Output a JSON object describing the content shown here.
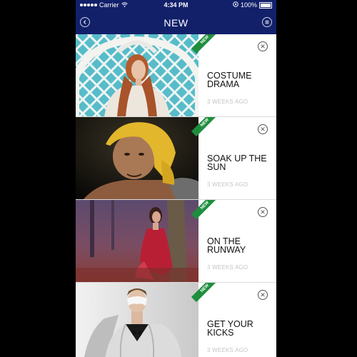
{
  "status": {
    "carrier": "Carrier",
    "time": "4:34 PM",
    "battery": "100%"
  },
  "navbar": {
    "title": "NEW",
    "left_icon": "back-arrow-icon",
    "right_icon": "menu-icon"
  },
  "articles": [
    {
      "badge": "NEW",
      "title": "COSTUME DRAMA",
      "age": "3 WEEKS AGO"
    },
    {
      "badge": "NEW",
      "title": "SOAK UP THE SUN",
      "age": "3 WEEKS AGO"
    },
    {
      "badge": "NEW",
      "title": "ON THE RUNWAY",
      "age": "3 WEEKS AGO"
    },
    {
      "badge": "NEW",
      "title": "GET YOUR KICKS",
      "age": "3 WEEKS AGO"
    }
  ],
  "colors": {
    "navbar": "#12206a",
    "badge": "#1e8e3e",
    "background": "#000000"
  }
}
